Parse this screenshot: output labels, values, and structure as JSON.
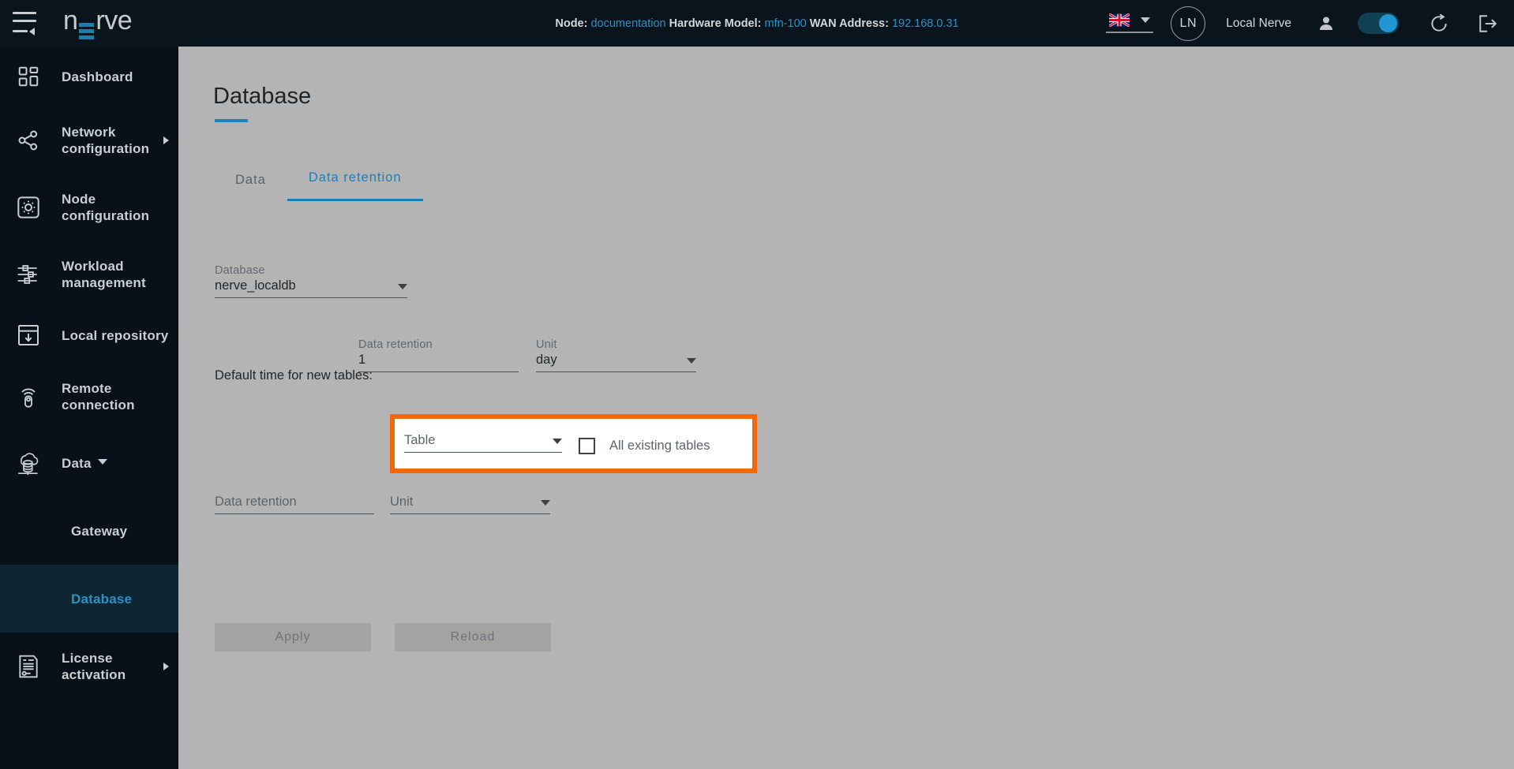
{
  "header": {
    "logo_text": "nerve",
    "menu_icon": "hamburger-collapse-icon",
    "node_label": "Node:",
    "node_value": "documentation",
    "hardware_label": "Hardware Model:",
    "hardware_value": "mfn-100",
    "wan_label": "WAN Address:",
    "wan_value": "192.168.0.31",
    "language_flag": "uk-flag-icon",
    "avatar_initials": "LN",
    "user_name": "Local Nerve",
    "person_icon": "person-icon",
    "toggle_state": "on",
    "reload_icon": "refresh-icon",
    "logout_icon": "logout-icon",
    "accent_color": "#2e8fc4"
  },
  "sidebar": {
    "background": "#081019",
    "active_background": "#0d2634",
    "items": [
      {
        "label": "Dashboard",
        "icon": "dashboard-icon",
        "has_arrow": false,
        "active": false
      },
      {
        "label": "Network configuration",
        "icon": "network-share-icon",
        "has_arrow": true,
        "active": false
      },
      {
        "label": "Node configuration",
        "icon": "gear-square-icon",
        "has_arrow": false,
        "active": false
      },
      {
        "label": "Workload management",
        "icon": "sliders-icon",
        "has_arrow": false,
        "active": false
      },
      {
        "label": "Local repository",
        "icon": "repository-download-icon",
        "has_arrow": false,
        "active": false
      },
      {
        "label": "Remote connection",
        "icon": "remote-control-icon",
        "has_arrow": false,
        "active": false
      },
      {
        "label": "Data",
        "icon": "cloud-database-icon",
        "has_caret": true,
        "active": false
      },
      {
        "label": "Gateway",
        "icon": "",
        "sub": true,
        "active": false
      },
      {
        "label": "Database",
        "icon": "",
        "sub": true,
        "active": true
      },
      {
        "label": "License activation",
        "icon": "license-document-icon",
        "has_arrow": true,
        "active": false
      }
    ]
  },
  "main": {
    "page_title": "Database",
    "tabs": [
      {
        "label": "Data",
        "active": false
      },
      {
        "label": "Data retention",
        "active": true
      }
    ],
    "database_field": {
      "label": "Database",
      "value": "nerve_localdb"
    },
    "default_row": {
      "label": "Default time for new tables:",
      "retention_label": "Data retention",
      "retention_value": "1",
      "unit_label": "Unit",
      "unit_value": "day"
    },
    "table_row": {
      "table_placeholder": "Table",
      "checkbox_label": "All existing tables",
      "checkbox_checked": false,
      "highlight_color": "#f2690b"
    },
    "entry_row": {
      "retention_placeholder": "Data retention",
      "unit_placeholder": "Unit"
    },
    "buttons": {
      "apply": "Apply",
      "reload": "Reload"
    }
  }
}
